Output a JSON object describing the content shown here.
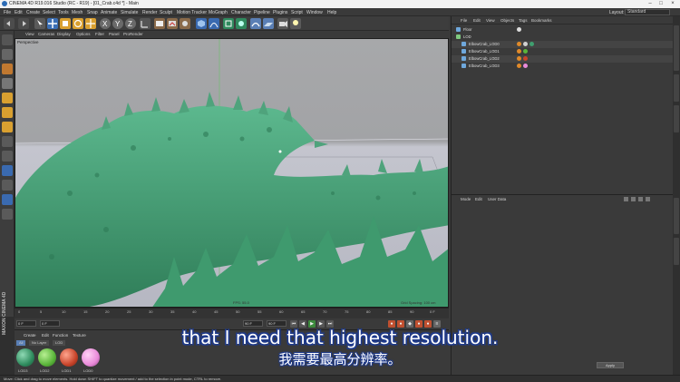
{
  "window": {
    "title": "CINEMA 4D R19.016 Studio (RC - R19) - [01_Crab.c4d *] - Main"
  },
  "menubar": {
    "items": [
      "File",
      "Edit",
      "Create",
      "Select",
      "Tools",
      "Mesh",
      "Snap",
      "Animate",
      "Simulate",
      "Render",
      "Sculpt",
      "Motion Tracker",
      "MoGraph",
      "Character",
      "Pipeline",
      "Plugins",
      "Script",
      "Window",
      "Help"
    ],
    "layout_label": "Layout:",
    "layout_value": "Standard"
  },
  "viewport": {
    "menu": [
      "View",
      "Cameras",
      "Display",
      "Options",
      "Filter",
      "Panel",
      "ProRender"
    ],
    "camera_label": "Perspective",
    "fps": "FPS: 55.0",
    "snap": "Grid Spacing: 100 cm"
  },
  "timeline": {
    "ticks": [
      "0",
      "5",
      "10",
      "15",
      "20",
      "25",
      "30",
      "35",
      "40",
      "45",
      "50",
      "55",
      "60",
      "65",
      "70",
      "75",
      "80",
      "85",
      "90"
    ],
    "end_frame": "0 F"
  },
  "transport": {
    "start": "0 F",
    "current": "0 F",
    "end": "90 F",
    "max": "90 F"
  },
  "materials": {
    "tabs": [
      "Create",
      "Edit",
      "Function",
      "Texture"
    ],
    "filters": [
      "All",
      "No Layer",
      "LOD"
    ],
    "items": [
      {
        "label": "LOD3",
        "color": "#2f8c5e"
      },
      {
        "label": "LOD2",
        "color": "#5ab53a"
      },
      {
        "label": "LOD1",
        "color": "#c8442a"
      },
      {
        "label": "LOD0",
        "color": "#e98ad9"
      }
    ]
  },
  "objects": {
    "menu": [
      "File",
      "Edit",
      "View",
      "Objects",
      "Tags",
      "Bookmarks"
    ],
    "rows": [
      {
        "name": "Floor",
        "indent": 0,
        "icon_color": "#6fa8dc",
        "tags": [
          "#dddddd"
        ]
      },
      {
        "name": "LOD",
        "indent": 0,
        "icon_color": "#7fc97f",
        "tags": []
      },
      {
        "name": "ElbowCrab_LOD0",
        "indent": 1,
        "icon_color": "#6fa8dc",
        "tags": [
          "#e08a2a",
          "#d0d0d0",
          "#3f9f6f"
        ]
      },
      {
        "name": "ElbowCrab_LOD1",
        "indent": 1,
        "icon_color": "#6fa8dc",
        "tags": [
          "#e08a2a",
          "#5ab53a"
        ]
      },
      {
        "name": "ElbowCrab_LOD2",
        "indent": 1,
        "icon_color": "#6fa8dc",
        "tags": [
          "#e08a2a",
          "#c8442a"
        ]
      },
      {
        "name": "ElbowCrab_LOD3",
        "indent": 1,
        "icon_color": "#6fa8dc",
        "tags": [
          "#e08a2a",
          "#e98ad9"
        ]
      }
    ]
  },
  "attributes": {
    "menu": [
      "Mode",
      "Edit",
      "User Data"
    ]
  },
  "bottom_right": {
    "apply_label": "Apply"
  },
  "maxon": "MAXON CINEMA 4D",
  "status_text": "Move: Click and drag to move elements. Hold down SHIFT to quantize movement / add to the selection in point mode, CTRL to remove.",
  "subtitles": {
    "english": "that I need that highest resolution.",
    "chinese": "我需要最高分辨率。"
  }
}
